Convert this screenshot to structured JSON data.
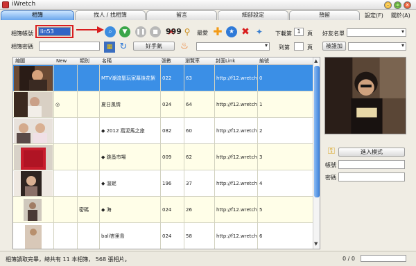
{
  "window": {
    "title": "iWretch"
  },
  "tabs": [
    {
      "label": "相簿",
      "active": true
    },
    {
      "label": "找人 / 找相簿",
      "active": false
    },
    {
      "label": "留言",
      "active": false
    },
    {
      "label": "細部設定",
      "active": false
    },
    {
      "label": "預留",
      "active": false
    }
  ],
  "menu": {
    "settings": "設定(F)",
    "about": "關於(A)"
  },
  "toolbar": {
    "account_label": "相簿帳號",
    "account_value": "lin53",
    "password_label": "相簿密碼",
    "password_value": "",
    "counter": "999",
    "favorite_label": "最愛",
    "good_friend_button": "好手氣",
    "favorite_select": "",
    "download_label": "下載第",
    "page_label": "頁",
    "download_page": "1",
    "to_label": "到第",
    "to_page": "",
    "to_page_label": "頁",
    "friends_label": "好友名單",
    "friends_select": "",
    "added_by_button": "被誰加",
    "added_by_select": "",
    "accent_color": "#3164c6",
    "highlight_color": "#d81e1e"
  },
  "grid": {
    "columns": [
      "縮圖",
      "New",
      "類別",
      "名稱",
      "張數",
      "瀏覽率",
      "封面Link",
      "編號"
    ],
    "rows": [
      {
        "new": "",
        "category": "",
        "name": "MTV潮流聖玩家幕後花絮",
        "count": "022",
        "views": "63",
        "link": "http://f12.wretch...",
        "index": "0",
        "selected": true
      },
      {
        "new": "◎",
        "category": "",
        "name": "夏日風情",
        "count": "024",
        "views": "64",
        "link": "http://f12.wretch...",
        "index": "1",
        "selected": false
      },
      {
        "new": "",
        "category": "",
        "name": "◆ 2012 窩泥馬之旅",
        "count": "082",
        "views": "60",
        "link": "http://f12.wretch...",
        "index": "2",
        "selected": false
      },
      {
        "new": "",
        "category": "",
        "name": "◆ 跳蚤市場",
        "count": "009",
        "views": "62",
        "link": "http://f12.wretch...",
        "index": "3",
        "selected": false
      },
      {
        "new": "",
        "category": "",
        "name": "◆ 溫妮",
        "count": "196",
        "views": "37",
        "link": "http://f12.wretch...",
        "index": "4",
        "selected": false
      },
      {
        "new": "",
        "category": "密碼",
        "name": "◆ 海",
        "count": "024",
        "views": "26",
        "link": "http://f12.wretch...",
        "index": "5",
        "selected": false
      },
      {
        "new": "",
        "category": "",
        "name": "bali峇里島",
        "count": "024",
        "views": "58",
        "link": "http://f12.wretch...",
        "index": "6",
        "selected": false
      }
    ]
  },
  "side": {
    "enter_mode_button": "進入模式",
    "account_label": "帳號",
    "account_value": "",
    "password_label": "密碼",
    "password_value": ""
  },
  "status": {
    "text": "相簿讀取完畢，總共有 11 本相簿， 568 張相片。",
    "count": "0 / 0",
    "progress": 0
  }
}
